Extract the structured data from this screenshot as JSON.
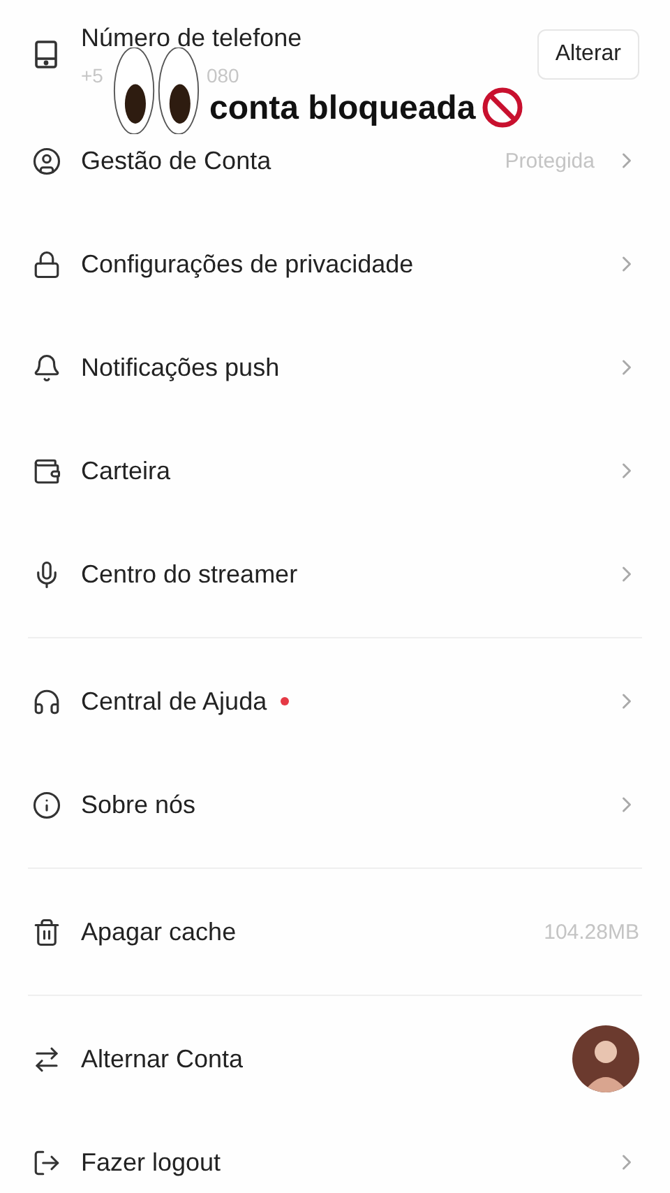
{
  "sections": [
    {
      "items": [
        {
          "kind": "phone",
          "label": "Número de telefone",
          "sub_parts": [
            "+5",
            "080"
          ],
          "button": "Alterar"
        },
        {
          "kind": "nav",
          "label": "Gestão de Conta",
          "value": "Protegida"
        },
        {
          "kind": "nav",
          "label": "Configurações de privacidade"
        },
        {
          "kind": "nav",
          "label": "Notificações push"
        },
        {
          "kind": "nav",
          "label": "Carteira"
        },
        {
          "kind": "nav",
          "label": "Centro do streamer"
        }
      ]
    },
    {
      "items": [
        {
          "kind": "nav",
          "label": "Central de Ajuda",
          "dot": true
        },
        {
          "kind": "nav",
          "label": "Sobre nós"
        }
      ]
    },
    {
      "items": [
        {
          "kind": "value",
          "label": "Apagar cache",
          "value": "104.28MB"
        }
      ]
    },
    {
      "items": [
        {
          "kind": "avatar",
          "label": "Alternar Conta"
        },
        {
          "kind": "nav",
          "label": "Fazer logout"
        }
      ]
    }
  ],
  "overlay": {
    "caption": "conta bloqueada"
  }
}
